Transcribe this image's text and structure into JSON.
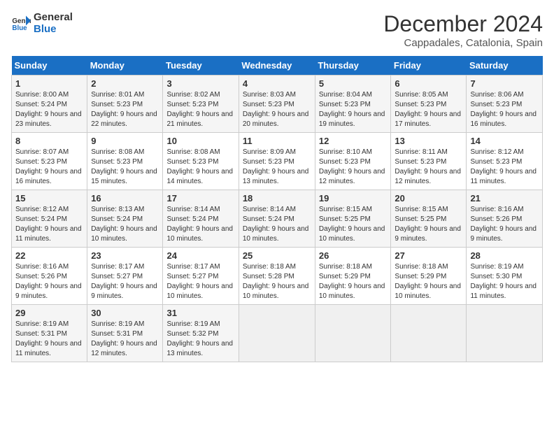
{
  "logo": {
    "line1": "General",
    "line2": "Blue"
  },
  "title": "December 2024",
  "location": "Cappadales, Catalonia, Spain",
  "headers": [
    "Sunday",
    "Monday",
    "Tuesday",
    "Wednesday",
    "Thursday",
    "Friday",
    "Saturday"
  ],
  "weeks": [
    [
      {
        "day": "1",
        "sunrise": "8:00 AM",
        "sunset": "5:24 PM",
        "daylight": "9 hours and 23 minutes."
      },
      {
        "day": "2",
        "sunrise": "8:01 AM",
        "sunset": "5:23 PM",
        "daylight": "9 hours and 22 minutes."
      },
      {
        "day": "3",
        "sunrise": "8:02 AM",
        "sunset": "5:23 PM",
        "daylight": "9 hours and 21 minutes."
      },
      {
        "day": "4",
        "sunrise": "8:03 AM",
        "sunset": "5:23 PM",
        "daylight": "9 hours and 20 minutes."
      },
      {
        "day": "5",
        "sunrise": "8:04 AM",
        "sunset": "5:23 PM",
        "daylight": "9 hours and 19 minutes."
      },
      {
        "day": "6",
        "sunrise": "8:05 AM",
        "sunset": "5:23 PM",
        "daylight": "9 hours and 17 minutes."
      },
      {
        "day": "7",
        "sunrise": "8:06 AM",
        "sunset": "5:23 PM",
        "daylight": "9 hours and 16 minutes."
      }
    ],
    [
      {
        "day": "8",
        "sunrise": "8:07 AM",
        "sunset": "5:23 PM",
        "daylight": "9 hours and 16 minutes."
      },
      {
        "day": "9",
        "sunrise": "8:08 AM",
        "sunset": "5:23 PM",
        "daylight": "9 hours and 15 minutes."
      },
      {
        "day": "10",
        "sunrise": "8:08 AM",
        "sunset": "5:23 PM",
        "daylight": "9 hours and 14 minutes."
      },
      {
        "day": "11",
        "sunrise": "8:09 AM",
        "sunset": "5:23 PM",
        "daylight": "9 hours and 13 minutes."
      },
      {
        "day": "12",
        "sunrise": "8:10 AM",
        "sunset": "5:23 PM",
        "daylight": "9 hours and 12 minutes."
      },
      {
        "day": "13",
        "sunrise": "8:11 AM",
        "sunset": "5:23 PM",
        "daylight": "9 hours and 12 minutes."
      },
      {
        "day": "14",
        "sunrise": "8:12 AM",
        "sunset": "5:23 PM",
        "daylight": "9 hours and 11 minutes."
      }
    ],
    [
      {
        "day": "15",
        "sunrise": "8:12 AM",
        "sunset": "5:24 PM",
        "daylight": "9 hours and 11 minutes."
      },
      {
        "day": "16",
        "sunrise": "8:13 AM",
        "sunset": "5:24 PM",
        "daylight": "9 hours and 10 minutes."
      },
      {
        "day": "17",
        "sunrise": "8:14 AM",
        "sunset": "5:24 PM",
        "daylight": "9 hours and 10 minutes."
      },
      {
        "day": "18",
        "sunrise": "8:14 AM",
        "sunset": "5:24 PM",
        "daylight": "9 hours and 10 minutes."
      },
      {
        "day": "19",
        "sunrise": "8:15 AM",
        "sunset": "5:25 PM",
        "daylight": "9 hours and 10 minutes."
      },
      {
        "day": "20",
        "sunrise": "8:15 AM",
        "sunset": "5:25 PM",
        "daylight": "9 hours and 9 minutes."
      },
      {
        "day": "21",
        "sunrise": "8:16 AM",
        "sunset": "5:26 PM",
        "daylight": "9 hours and 9 minutes."
      }
    ],
    [
      {
        "day": "22",
        "sunrise": "8:16 AM",
        "sunset": "5:26 PM",
        "daylight": "9 hours and 9 minutes."
      },
      {
        "day": "23",
        "sunrise": "8:17 AM",
        "sunset": "5:27 PM",
        "daylight": "9 hours and 9 minutes."
      },
      {
        "day": "24",
        "sunrise": "8:17 AM",
        "sunset": "5:27 PM",
        "daylight": "9 hours and 10 minutes."
      },
      {
        "day": "25",
        "sunrise": "8:18 AM",
        "sunset": "5:28 PM",
        "daylight": "9 hours and 10 minutes."
      },
      {
        "day": "26",
        "sunrise": "8:18 AM",
        "sunset": "5:29 PM",
        "daylight": "9 hours and 10 minutes."
      },
      {
        "day": "27",
        "sunrise": "8:18 AM",
        "sunset": "5:29 PM",
        "daylight": "9 hours and 10 minutes."
      },
      {
        "day": "28",
        "sunrise": "8:19 AM",
        "sunset": "5:30 PM",
        "daylight": "9 hours and 11 minutes."
      }
    ],
    [
      {
        "day": "29",
        "sunrise": "8:19 AM",
        "sunset": "5:31 PM",
        "daylight": "9 hours and 11 minutes."
      },
      {
        "day": "30",
        "sunrise": "8:19 AM",
        "sunset": "5:31 PM",
        "daylight": "9 hours and 12 minutes."
      },
      {
        "day": "31",
        "sunrise": "8:19 AM",
        "sunset": "5:32 PM",
        "daylight": "9 hours and 13 minutes."
      },
      null,
      null,
      null,
      null
    ]
  ]
}
